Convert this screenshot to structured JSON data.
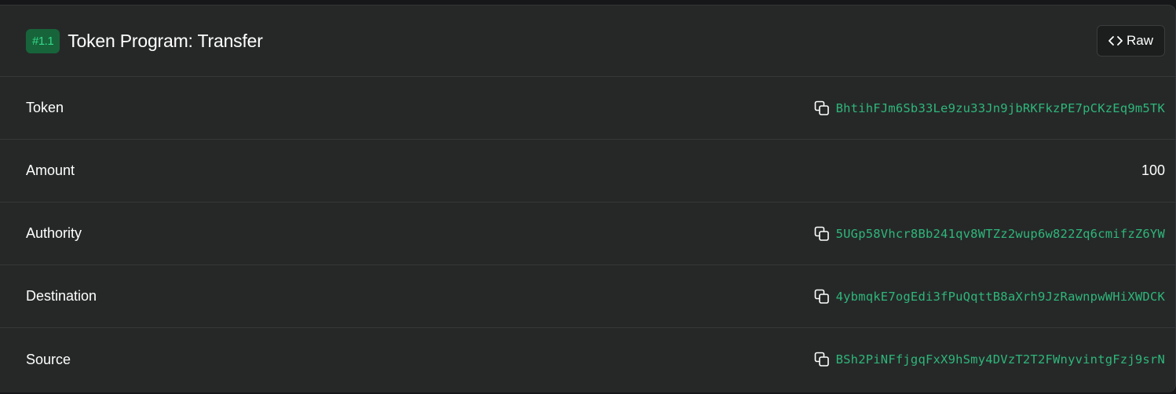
{
  "header": {
    "badge": "#1.1",
    "title": "Token Program: Transfer",
    "raw_label": "Raw"
  },
  "rows": [
    {
      "label": "Token",
      "value": "BhtihFJm6Sb33Le9zu33Jn9jbRKFkzPE7pCKzEq9m5TK",
      "copyable": true
    },
    {
      "label": "Amount",
      "value": "100",
      "copyable": false
    },
    {
      "label": "Authority",
      "value": "5UGp58Vhcr8Bb241qv8WTZz2wup6w822Zq6cmifzZ6YW",
      "copyable": true
    },
    {
      "label": "Destination",
      "value": "4ybmqkE7ogEdi3fPuQqttB8aXrh9JzRawnpwWHiXWDCK",
      "copyable": true
    },
    {
      "label": "Source",
      "value": "BSh2PiNFfjgqFxX9hSmy4DVzT2T2FWnyvintgFzj9srN",
      "copyable": true
    }
  ],
  "icons": {
    "code": "code-icon",
    "copy": "copy-icon"
  },
  "colors": {
    "card_background": "#262828",
    "badge_background": "#17643a",
    "badge_text": "#33d98a",
    "address_text": "#2eb67a"
  }
}
